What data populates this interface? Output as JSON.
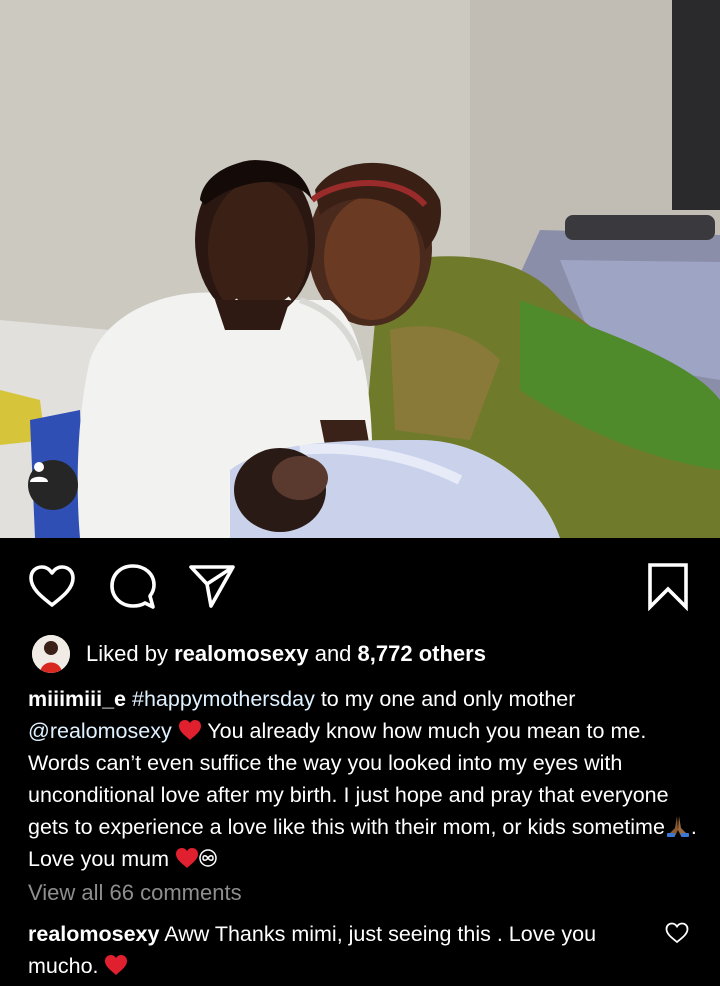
{
  "post": {
    "photo_alt": "",
    "user_tag_icon": "person-icon"
  },
  "actions": {
    "like_icon": "heart-outline-icon",
    "comment_icon": "comment-bubble-icon",
    "share_icon": "paper-plane-icon",
    "save_icon": "bookmark-icon"
  },
  "likes": {
    "prefix": "Liked by ",
    "user": "realomosexy",
    "middle": " and ",
    "count": "8,772 others"
  },
  "caption": {
    "username": "miiimiii_e",
    "hashtag": "#happymothersday",
    "text1": " to my one and only mother ",
    "mention": "@realomosexy",
    "text2": " You already know how much you mean to me. Words can’t even suffice the way you looked into my eyes with unconditional love after my birth. I just hope and pray that everyone gets to experience a love like this with their mom, or kids sometime",
    "text3": ". Love you mum "
  },
  "view_all": "View all 66 comments",
  "comment": {
    "username": "realomosexy",
    "text": " Aww Thanks mimi, just seeing this . Love you mucho. "
  },
  "colors": {
    "background": "#000000",
    "text": "#ffffff",
    "muted": "#8e8e8e",
    "heart_emoji": "#e0202e"
  }
}
